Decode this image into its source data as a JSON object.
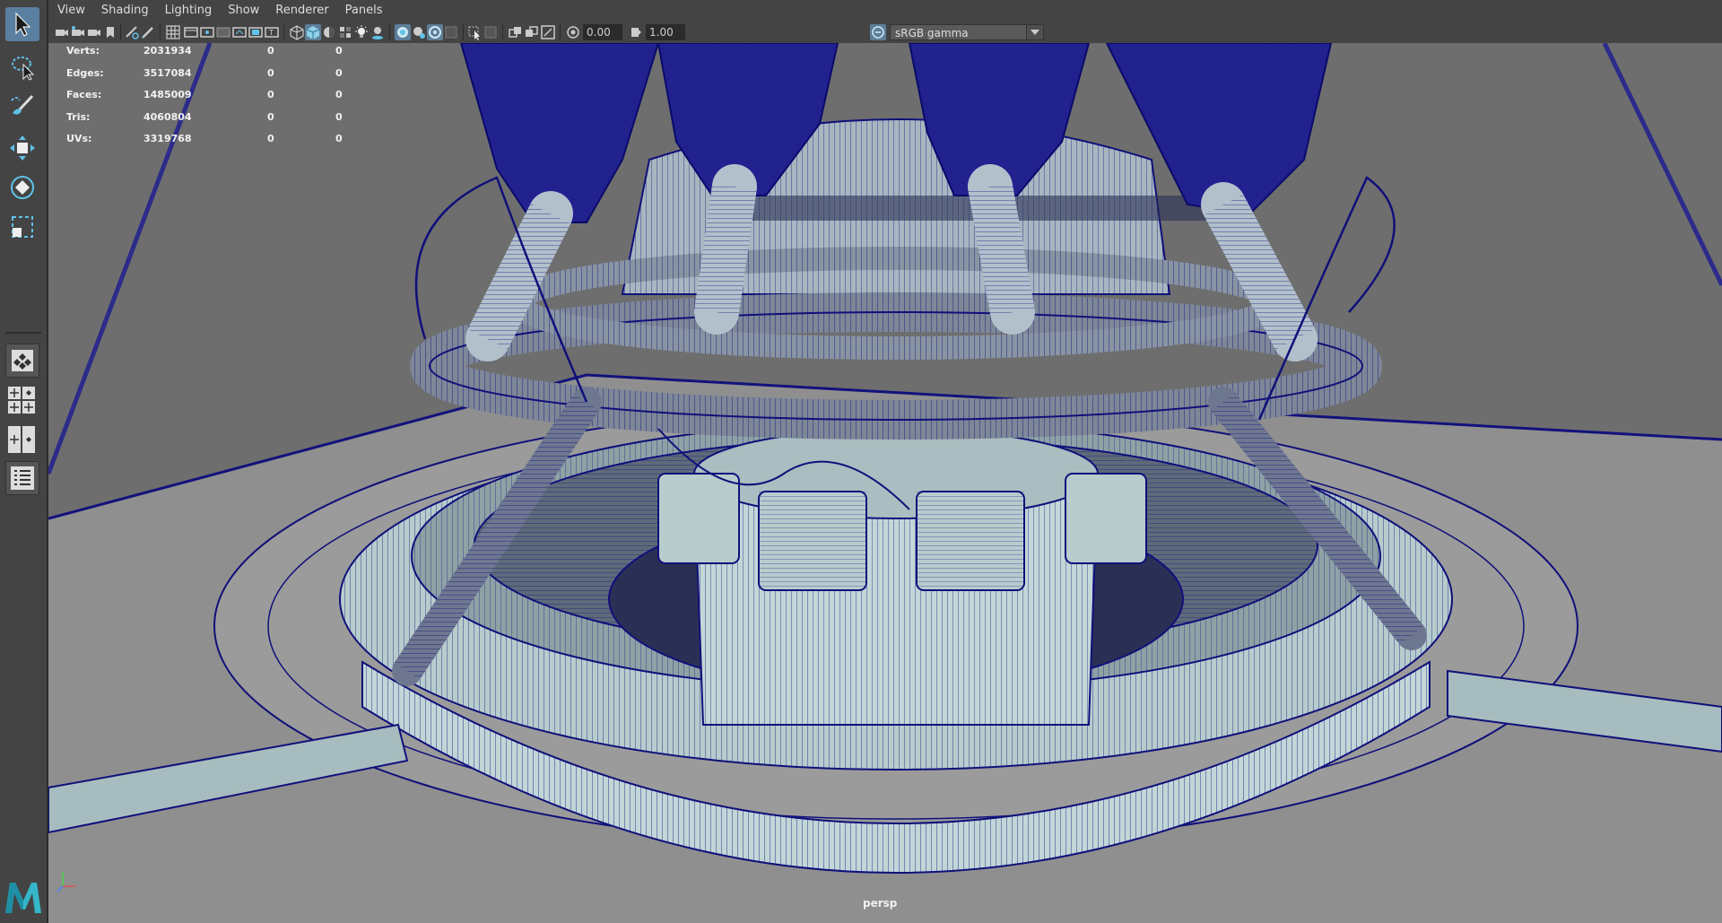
{
  "menubar": {
    "items": [
      "View",
      "Shading",
      "Lighting",
      "Show",
      "Renderer",
      "Panels"
    ]
  },
  "toolbar": {
    "exposure_value": "0.00",
    "gamma_value": "1.00",
    "color_space": "sRGB gamma"
  },
  "hud": {
    "rows": [
      {
        "label": "Verts:",
        "total": "2031934",
        "selected": "0",
        "components": "0"
      },
      {
        "label": "Edges:",
        "total": "3517084",
        "selected": "0",
        "components": "0"
      },
      {
        "label": "Faces:",
        "total": "1485009",
        "selected": "0",
        "components": "0"
      },
      {
        "label": "Tris:",
        "total": "4060804",
        "selected": "0",
        "components": "0"
      },
      {
        "label": "UVs:",
        "total": "3319768",
        "selected": "0",
        "components": "0"
      }
    ]
  },
  "viewport": {
    "camera_name": "persp"
  },
  "toolbox": {
    "tools": [
      "select-tool-icon",
      "lasso-tool-icon",
      "paint-select-tool-icon",
      "move-tool-icon",
      "rotate-tool-icon",
      "scale-tool-icon"
    ],
    "layout_buttons": [
      "single-pane-layout-icon",
      "four-pane-layout-icon",
      "two-pane-layout-icon",
      "outliner-layout-icon"
    ]
  },
  "colors": {
    "ui_bg": "#444444",
    "viewport_bg": "#707070",
    "wire": "#0a0a78",
    "mesh_fill": "#a9c1c4",
    "active_tool": "#5a7fa0"
  }
}
